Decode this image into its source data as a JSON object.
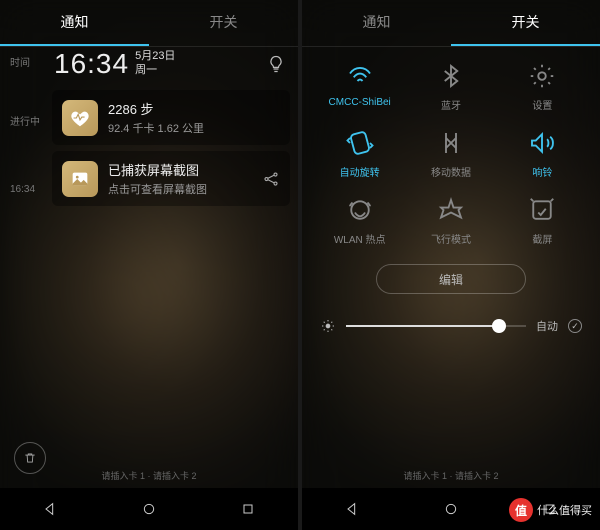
{
  "tabs": {
    "notify": "通知",
    "toggle": "开关"
  },
  "left": {
    "sidebar": {
      "time": "时间",
      "ongoing": "进行中",
      "ts": "16:34"
    },
    "clock": "16:34",
    "date": "5月23日",
    "weekday": "周一",
    "health": {
      "title": "2286 步",
      "sub": "92.4 千卡   1.62 公里"
    },
    "screenshot": {
      "title": "已捕获屏幕截图",
      "sub": "点击可查看屏幕截图"
    },
    "sim": "请插入卡 1 · 请插入卡 2"
  },
  "right": {
    "toggles": [
      {
        "label": "CMCC-ShiBei",
        "on": true
      },
      {
        "label": "蓝牙",
        "on": false
      },
      {
        "label": "设置",
        "on": false
      },
      {
        "label": "自动旋转",
        "on": true
      },
      {
        "label": "移动数据",
        "on": false
      },
      {
        "label": "响铃",
        "on": true
      },
      {
        "label": "WLAN 热点",
        "on": false
      },
      {
        "label": "飞行模式",
        "on": false
      },
      {
        "label": "截屏",
        "on": false
      }
    ],
    "edit": "编辑",
    "auto": "自动",
    "sim": "请插入卡 1 · 请插入卡 2"
  },
  "watermark": {
    "badge": "值",
    "text": "什么值得买"
  }
}
